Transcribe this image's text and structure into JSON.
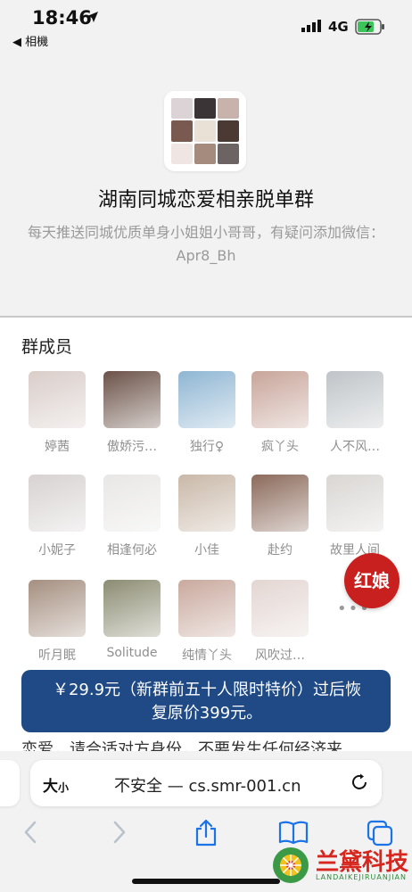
{
  "status_bar": {
    "time": "18:46",
    "back_app": "◀ 相機",
    "network": "4G"
  },
  "group": {
    "title": "湖南同城恋爱相亲脱单群",
    "description_line1": "每天推送同城优质单身小姐姐小哥哥，有疑问添加微信：",
    "description_line2": "Apr8_Bh",
    "avatar_colors": [
      "#dcd3d6",
      "#3a3436",
      "#c7b2ac",
      "#7a5a50",
      "#e9e1d6",
      "#4b3a34",
      "#efe6e4",
      "#a58a7e",
      "#6b6463"
    ]
  },
  "members": {
    "title": "群成员",
    "list": [
      {
        "name": "婷茜",
        "color": "#d9cdc9"
      },
      {
        "name": "傲娇污…",
        "color": "#6b5248"
      },
      {
        "name": "独行♀",
        "color": "#8fb6d3"
      },
      {
        "name": "疯丫头",
        "color": "#c8a59a"
      },
      {
        "name": "人不风…",
        "color": "#bfc4c8"
      },
      {
        "name": "小妮子",
        "color": "#d8d2d2"
      },
      {
        "name": "相逢何必",
        "color": "#e8e7e5"
      },
      {
        "name": "小佳",
        "color": "#c9b8a8"
      },
      {
        "name": "赴约",
        "color": "#8b6a5b"
      },
      {
        "name": "故里人间",
        "color": "#d9d6d3"
      },
      {
        "name": "听月眠",
        "color": "#a58f80"
      },
      {
        "name": "Solitude",
        "color": "#8c8c73"
      },
      {
        "name": "纯情丫头",
        "color": "#c9a99e"
      },
      {
        "name": "风吹过…",
        "color": "#e3d6d2"
      }
    ],
    "more": "•••"
  },
  "badge": {
    "label": "红娘"
  },
  "price": {
    "line1": "￥29.9元（新群前五十人限时特价）过后恢",
    "line2": "复原价399元。",
    "behind_text": "恋爱，请合适对方身份，不要发生任何经济来"
  },
  "browser": {
    "aa_big": "大",
    "aa_small": "小",
    "url": "不安全 — cs.smr-001.cn"
  },
  "watermark": {
    "title": "兰黛科技",
    "subtitle": "LANDAIKEJIRUANJIAN"
  }
}
